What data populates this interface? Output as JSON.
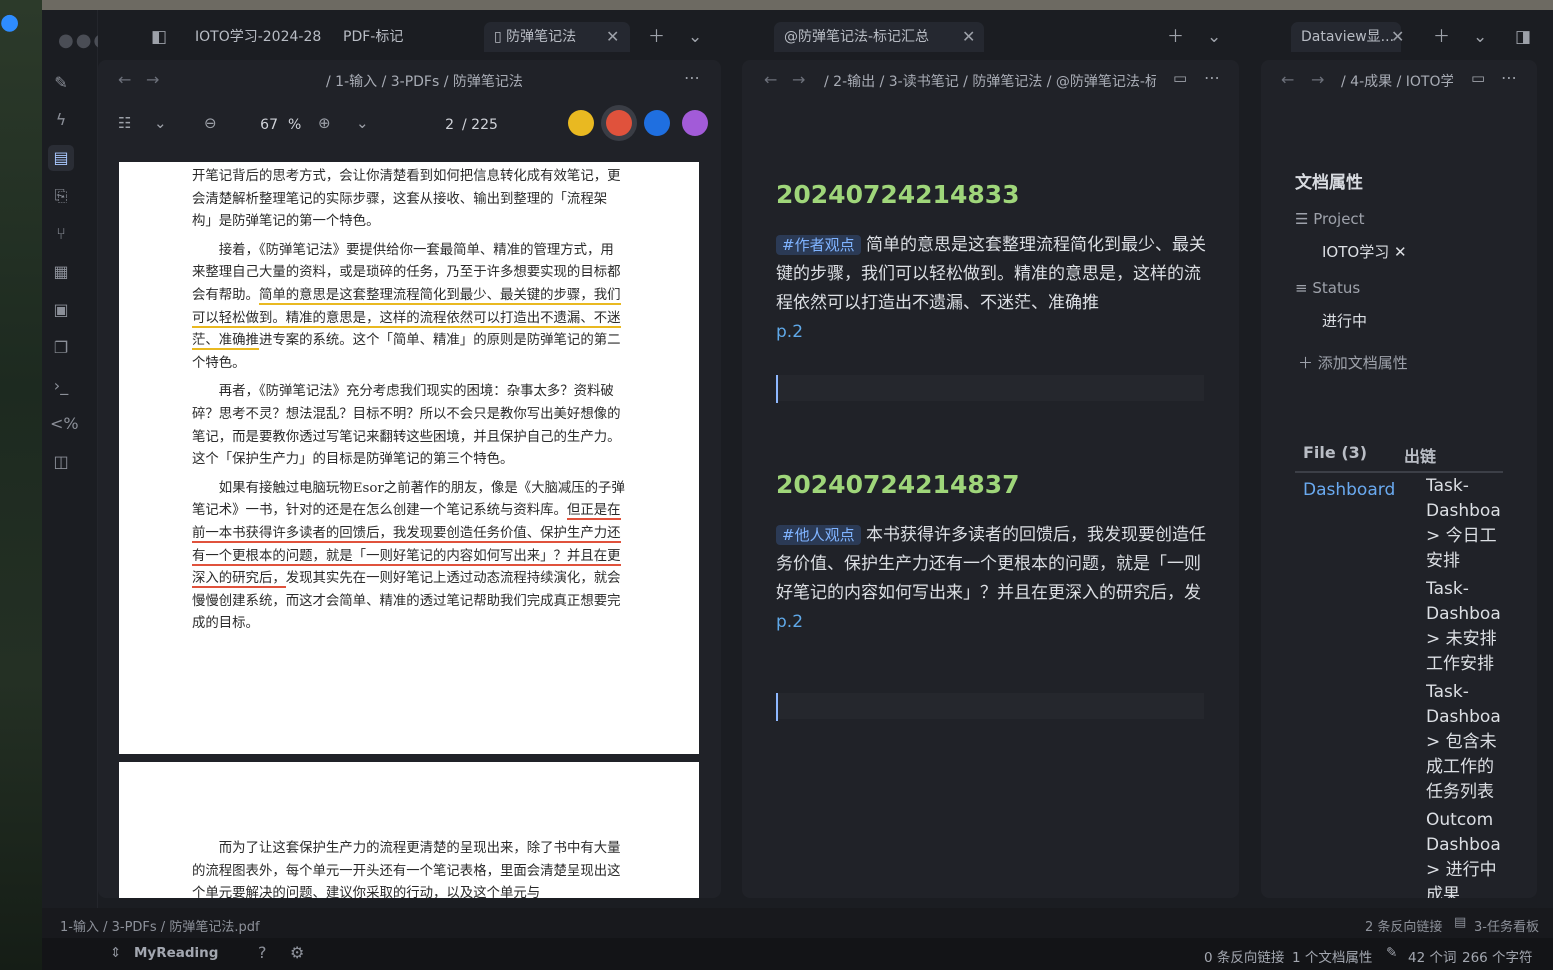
{
  "window": {
    "tabs_left": [
      {
        "label": "IOTO学习-2024-28"
      },
      {
        "label": "PDF-标记"
      },
      {
        "label": "防弹笔记法",
        "active": true
      }
    ],
    "tab_middle": {
      "label": "@防弹笔记法-标记汇总"
    },
    "tab_right": {
      "label": "Dataview显..."
    }
  },
  "pdf_pane": {
    "breadcrumb": "/ 1-输入 / 3-PDFs / 防弹笔记法",
    "zoom_value": "67",
    "zoom_unit": "%",
    "page_value": "2",
    "page_total": "/ 225",
    "highlight_colors": [
      "#e9b921",
      "#e0523c",
      "#1f6fe0",
      "#a25bd8"
    ],
    "page1": {
      "p1": "开笔记背后的思考方式，会让你清楚看到如何把信息转化成有效笔记，更会清楚解析整理笔记的实际步骤，这套从接收、输出到整理的「流程架构」是防弹笔记的第一个特色。",
      "p2_a": "接着，《防弹笔记法》要提供给你一套最简单、精准的管理方式，用来整理自己大量的资料，或是琐碎的任务，乃至于许多想要实现的目标都会有帮助。",
      "p2_hl": "简单的意思是这套整理流程简化到最少、最关键的步骤，我们可以轻松做到。精准的意思是，这样的流程依然可以打造出不遗漏、不迷茫、准确推",
      "p2_b": "进专案的系统。这个「简单、精准」的原则是防弹笔记的第二个特色。",
      "p3": "再者，《防弹笔记法》充分考虑我们现实的困境：杂事太多？资料破碎？思考不灵？想法混乱？目标不明？所以不会只是教你写出美好想像的笔记，而是要教你透过写笔记来翻转这些困境，并且保护自己的生产力。这个「保护生产力」的目标是防弹笔记的第三个特色。",
      "p4_a": "如果有接触过电脑玩物Esor之前著作的朋友，像是《大脑减压的子弹笔记术》一书，针对的还是在怎么创建一个笔记系统与资料库。",
      "p4_hl": "但正是在前一本书获得许多读者的回馈后，我发现要创造任务价值、保护生产力还有一个更根本的问题，就是「一则好笔记的内容如何写出来」？并且在更深入的研究后，",
      "p4_b": "发现其实先在一则好笔记上透过动态流程持续演化，就会慢慢创建系统，而这才会简单、精准的透过笔记帮助我们完成真正想要完成的目标。"
    },
    "page2": {
      "p1": "而为了让这套保护生产力的流程更清楚的呈现出来，除了书中有大量的流程图表外，每个单元一开头还有一个笔记表格，里面会清楚呈现出这个单元要解决的问题、建议你采取的行动，以及这个单元与"
    }
  },
  "note_pane": {
    "breadcrumb": "/ 2-输出 / 3-读书笔记 / 防弹笔记法 / @防弹笔记法-标",
    "entries": [
      {
        "id": "20240724214833",
        "tag": "#作者观点",
        "text": "简单的意思是这套整理流程简化到最少、最关键的步骤，我们可以轻松做到。精准的意思是，这样的流程依然可以打造出不遗漏、不迷茫、准确推",
        "page": "p.2"
      },
      {
        "id": "20240724214837",
        "tag": "#他人观点",
        "text": "本书获得许多读者的回馈后，我发现要创造任务价值、保护生产力还有一个更根本的问题，就是「一则好笔记的内容如何写出来」？并且在更深入的研究后，发",
        "page": "p.2"
      }
    ]
  },
  "props_pane": {
    "breadcrumb": "/ 4-成果 / IOTO学",
    "title": "文档属性",
    "project_label": "Project",
    "project_value": "IOTO学习",
    "status_label": "Status",
    "status_value": "进行中",
    "add_prop": "添加文档属性",
    "file_tab": "File (3)",
    "outlinks_tab": "出链",
    "dashboard_link": "Dashboard",
    "outline_items": [
      [
        "Task-",
        "Dashboa",
        "> 今日工",
        "安排"
      ],
      [
        "Task-",
        "Dashboa",
        "> 未安排",
        "工作安排"
      ],
      [
        "Task-",
        "Dashboa",
        "> 包含未",
        "成工作的",
        "任务列表"
      ],
      [
        "Outcom",
        "Dashboa",
        "> 进行中",
        "成果"
      ]
    ]
  },
  "statusbar": {
    "path": "1-输入 / 3-PDFs / 防弹笔记法.pdf",
    "backlinks": "2 条反向链接",
    "kanban": "3-任务看板"
  },
  "bottom_bar": {
    "vault": "MyReading",
    "backlinks": "0 条反向链接",
    "props": "1 个文档属性",
    "words": "42 个词",
    "chars": "266 个字符"
  }
}
